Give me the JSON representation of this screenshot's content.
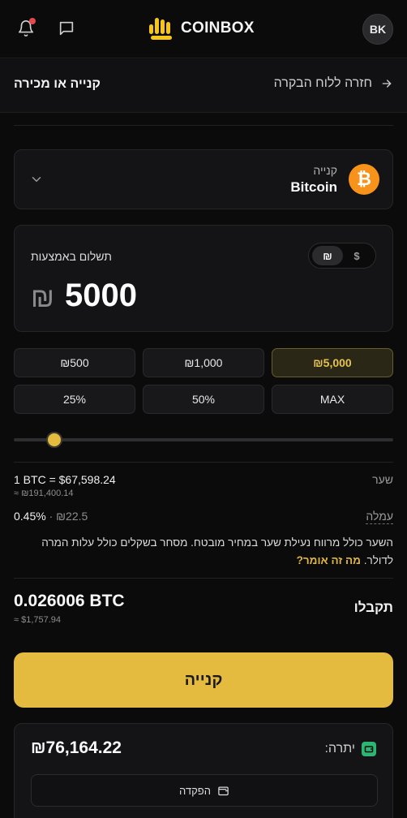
{
  "header": {
    "logo_text": "COINBOX",
    "avatar_initials": "BK",
    "brand_color": "#f5c518"
  },
  "subheader": {
    "title": "קנייה או מכירה",
    "back_label": "חזרה ללוח הבקרה"
  },
  "asset": {
    "action": "קנייה",
    "name": "Bitcoin",
    "icon": "bitcoin-icon",
    "icon_color": "#f7931a"
  },
  "payment": {
    "label": "תשלום באמצעות",
    "currency_symbol": "₪",
    "amount": "5000",
    "toggle": {
      "ils": "₪",
      "usd": "$",
      "selected": "ils"
    }
  },
  "amount_chips": [
    "₪500",
    "₪1,000",
    "₪5,000"
  ],
  "percent_chips": [
    "25%",
    "50%",
    "MAX"
  ],
  "active_chip": "₪5,000",
  "slider": {
    "value_fraction": 0.09
  },
  "rate": {
    "label": "שער",
    "main": "1 BTC = $67,598.24",
    "sub": "≈ ₪191,400.14"
  },
  "fee": {
    "label": "עמלה",
    "percent": "0.45%",
    "separator": "·",
    "amount": "₪22.5"
  },
  "note": {
    "text": "השער כולל מרווח נעילת שער במחיר מובטח. מסחר בשקלים כולל עלות המרה לדולר.",
    "link": "מה זה אומר?"
  },
  "receive": {
    "label": "תקבלו",
    "value": "0.026006 BTC",
    "sub": "≈ $1,757.94"
  },
  "buy_button": "קנייה",
  "balance": {
    "label": "יתרה:",
    "value": "₪76,164.22",
    "deposit_label": "הפקדה"
  },
  "colors": {
    "accent": "#e5bb3f",
    "background": "#0b0b0c",
    "card": "#141416"
  }
}
